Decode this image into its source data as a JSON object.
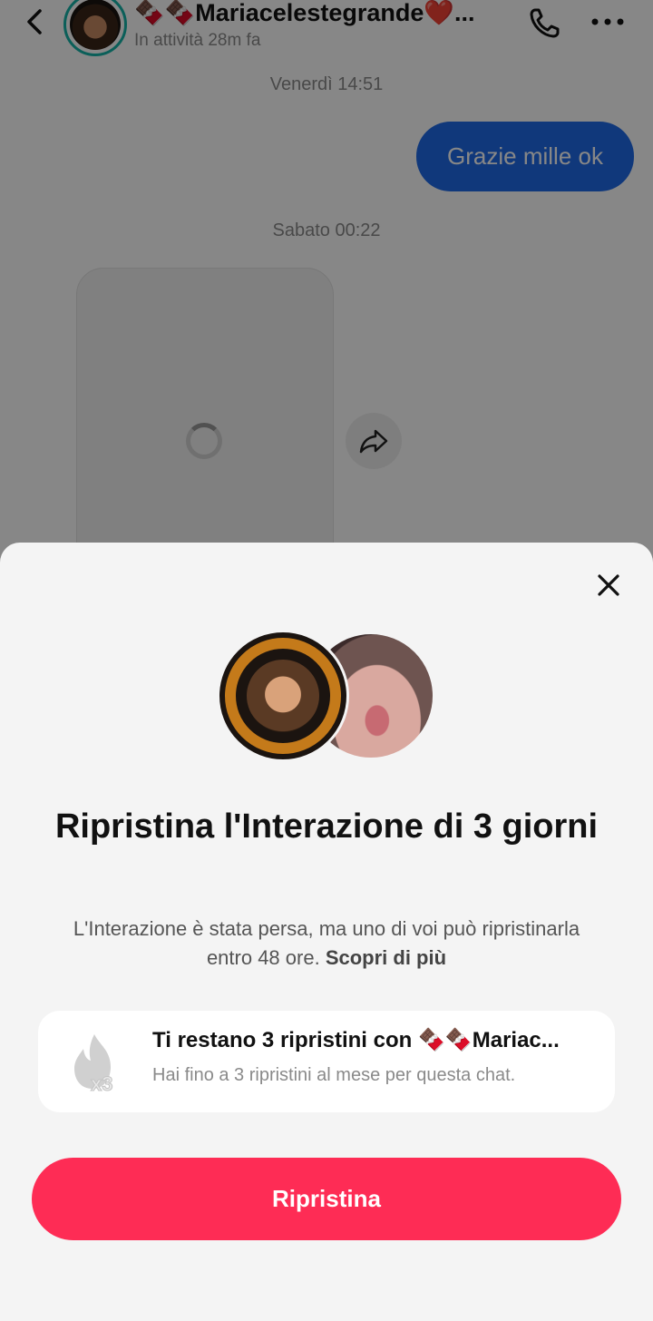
{
  "header": {
    "contact_name": "🍫🍫Mariacelestegrande❤️...",
    "status": "In attività 28m fa"
  },
  "chat": {
    "timestamp_1": "Venerdì 14:51",
    "outgoing_message": "Grazie mille ok",
    "timestamp_2": "Sabato 00:22"
  },
  "sheet": {
    "title": "Ripristina l'Interazione di 3 giorni",
    "description": "L'Interazione è stata persa, ma uno di voi può ripristinarla entro 48 ore.",
    "learn_more": "Scopri di più",
    "card_title": "Ti restano 3 ripristini con 🍫🍫Mariac...",
    "card_subtitle": "Hai fino a 3 ripristini al mese per questa chat.",
    "flame_badge": "x3",
    "restore_button": "Ripristina"
  },
  "colors": {
    "accent_button": "#fe2c55",
    "outgoing_bubble": "#1f6be8",
    "online_ring": "#16b3a8"
  },
  "icons": [
    "back-icon",
    "phone-icon",
    "more-icon",
    "share-icon",
    "close-icon",
    "flame-icon"
  ]
}
